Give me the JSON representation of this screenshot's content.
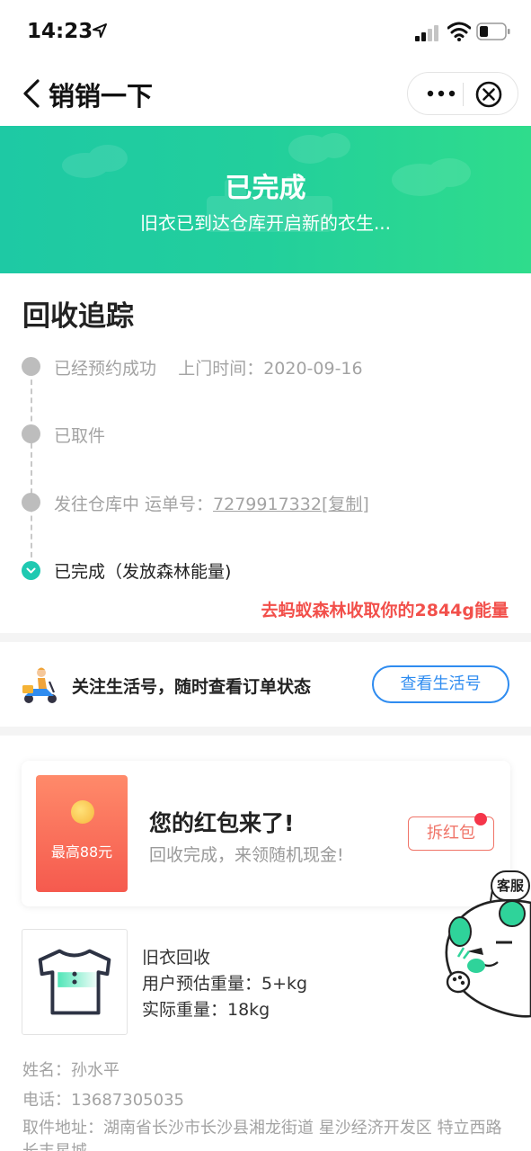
{
  "status_bar": {
    "time": "14:23"
  },
  "nav": {
    "title": "销销一下"
  },
  "banner": {
    "title": "已完成",
    "subtitle": "旧衣已到达仓库开启新的衣生..."
  },
  "tracking": {
    "title": "回收追踪",
    "steps": [
      {
        "label": "已经预约成功",
        "extra": "上门时间：2020-09-16",
        "done": true
      },
      {
        "label": "已取件",
        "done": true
      },
      {
        "label": "发往仓库中 运单号：",
        "waybill": "7279917332",
        "copy": "[复制]",
        "done": true
      },
      {
        "label": "已完成（发放森林能量)",
        "done": true,
        "current": true
      }
    ],
    "energy_link": "去蚂蚁森林收取你的2844g能量"
  },
  "follow": {
    "text": "关注生活号，随时查看订单状态",
    "button": "查看生活号"
  },
  "red_packet": {
    "image_label": "最高88元",
    "title": "您的红包来了!",
    "subtitle": "回收完成，来领随机现金!",
    "button": "拆红包"
  },
  "item": {
    "name": "旧衣回收",
    "estimated_weight": "用户预估重量：5+kg",
    "actual_weight": "实际重量：18kg"
  },
  "info": {
    "name": "姓名：孙水平",
    "phone": "电话：13687305035",
    "address": "取件地址：湖南省长沙市长沙县湘龙街道 星沙经济开发区 特立西路 长丰星城"
  },
  "service": {
    "label": "客服"
  },
  "colors": {
    "banner": "#22cf9c",
    "accent": "#1fc9b1",
    "link_blue": "#2f8cf0",
    "energy_red": "#f2504b"
  }
}
